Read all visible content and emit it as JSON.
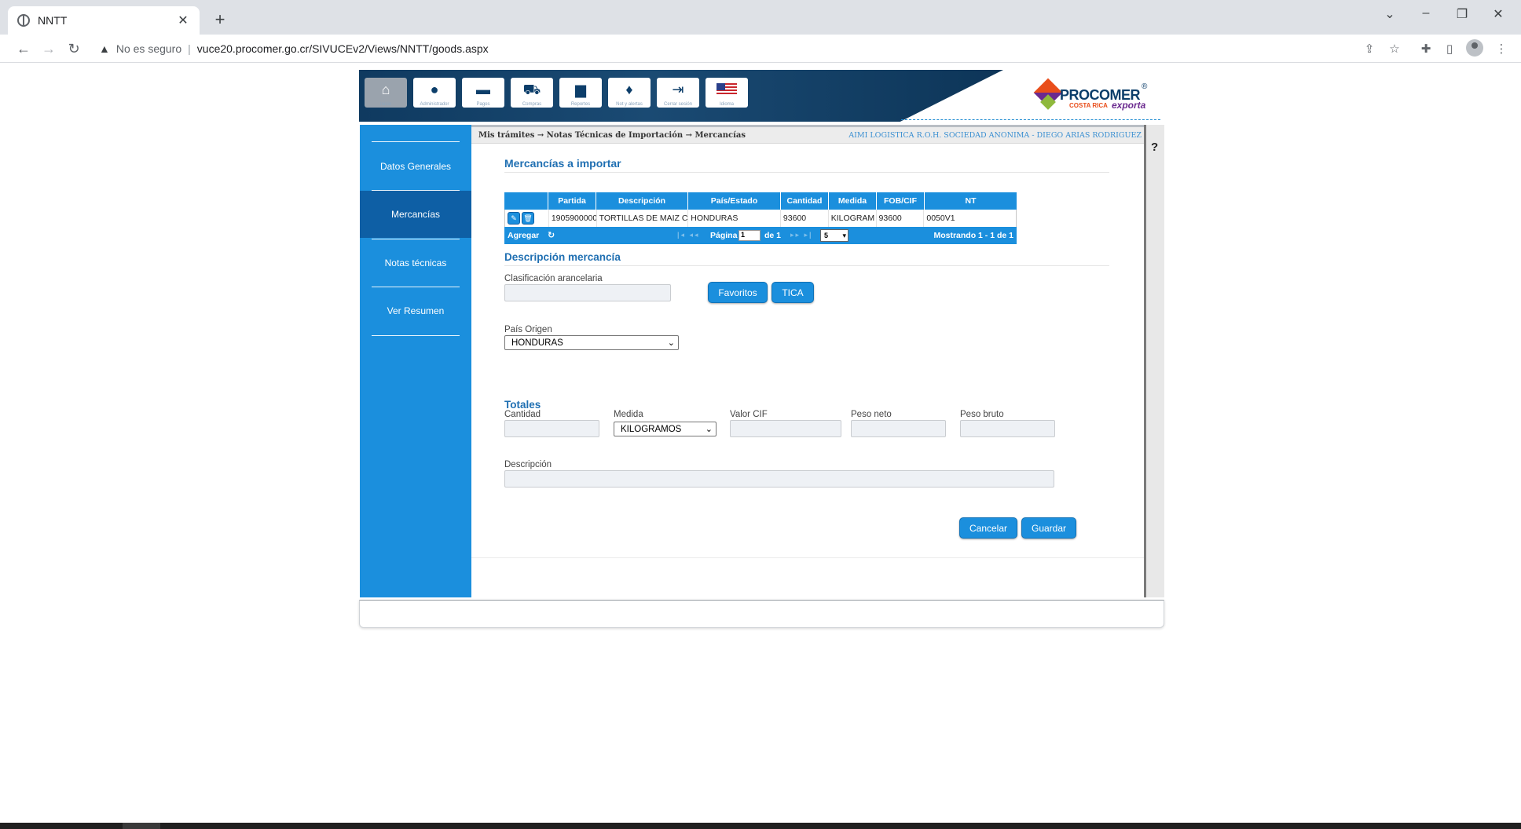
{
  "browser": {
    "tab_title": "NNTT",
    "security_label": "No es seguro",
    "url": "vuce20.procomer.go.cr/SIVUCEv2/Views/NNTT/goods.aspx"
  },
  "header": {
    "icons": [
      {
        "label": "Inicio",
        "icon": "home-icon"
      },
      {
        "label": "Administrador",
        "icon": "user-icon"
      },
      {
        "label": "Pagos",
        "icon": "card-icon"
      },
      {
        "label": "Compras",
        "icon": "cart-icon"
      },
      {
        "label": "Reportes",
        "icon": "chart-icon"
      },
      {
        "label": "Not y alertas",
        "icon": "bulb-icon"
      },
      {
        "label": "Cerrar sesión",
        "icon": "logout-icon"
      },
      {
        "label": "Idioma",
        "icon": "us-flag-icon"
      }
    ],
    "logo": {
      "name": "PROCOMER",
      "sub1": "COSTA RICA",
      "sub2": "exporta",
      "reg": "®"
    }
  },
  "sidebar": {
    "items": [
      {
        "label": "Datos Generales"
      },
      {
        "label": "Mercancías"
      },
      {
        "label": "Notas técnicas"
      },
      {
        "label": "Ver Resumen"
      }
    ]
  },
  "breadcrumb": "Mis trámites → Notas Técnicas de Importación → Mercancías",
  "user_info": "AIMI LOGISTICA R.O.H. SOCIEDAD ANONIMA - DIEGO ARIAS RODRIGUEZ",
  "help_label": "?",
  "mercancias": {
    "title": "Mercancías a importar",
    "columns": [
      "",
      "Partida",
      "Descripción",
      "País/Estado",
      "Cantidad",
      "Medida",
      "FOB/CIF",
      "NT"
    ],
    "rows": [
      {
        "partida": "1905900000",
        "descripcion": "TORTILLAS DE MAIZ C",
        "pais": "HONDURAS",
        "cantidad": "93600",
        "medida": "KILOGRAM",
        "fob": "93600",
        "nt": "0050V1"
      }
    ],
    "footer": {
      "agregar": "Agregar",
      "pagina": "Página",
      "page_value": "1",
      "de": "de 1",
      "rows_per_page": "5",
      "mostrando": "Mostrando 1 - 1 de 1"
    }
  },
  "descripcion": {
    "title": "Descripción mercancía",
    "clasificacion_label": "Clasificación arancelaria",
    "favoritos_label": "Favoritos",
    "tica_label": "TICA",
    "pais_origen_label": "País Origen",
    "pais_origen_value": "HONDURAS"
  },
  "totales": {
    "title": "Totales",
    "cantidad_label": "Cantidad",
    "medida_label": "Medida",
    "medida_value": "KILOGRAMOS",
    "valor_cif_label": "Valor CIF",
    "peso_neto_label": "Peso neto",
    "peso_bruto_label": "Peso bruto",
    "descripcion_label": "Descripción"
  },
  "actions": {
    "cancel_label": "Cancelar",
    "save_label": "Guardar"
  },
  "colors": {
    "accent": "#1b8fdd",
    "active_nav": "#0e5fa5",
    "title": "#1f6fb2"
  }
}
